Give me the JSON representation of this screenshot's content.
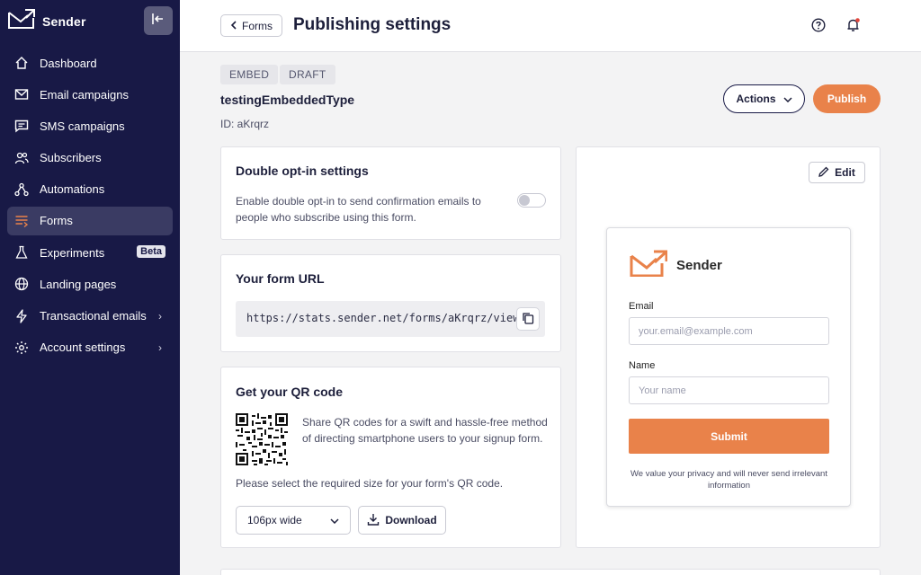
{
  "app": {
    "name": "Sender"
  },
  "sidebar": {
    "items": [
      {
        "label": "Dashboard",
        "icon": "home-icon"
      },
      {
        "label": "Email campaigns",
        "icon": "mail-icon"
      },
      {
        "label": "SMS campaigns",
        "icon": "message-icon"
      },
      {
        "label": "Subscribers",
        "icon": "users-icon"
      },
      {
        "label": "Automations",
        "icon": "automation-icon"
      },
      {
        "label": "Forms",
        "icon": "forms-icon",
        "active": true
      },
      {
        "label": "Experiments",
        "icon": "flask-icon",
        "badge": "Beta"
      },
      {
        "label": "Landing pages",
        "icon": "globe-icon"
      },
      {
        "label": "Transactional emails",
        "icon": "lightning-icon",
        "chevron": "›"
      },
      {
        "label": "Account settings",
        "icon": "gear-icon",
        "chevron": "›"
      }
    ]
  },
  "topbar": {
    "back_label": "Forms",
    "title": "Publishing settings"
  },
  "header": {
    "tags": [
      "EMBED",
      "DRAFT"
    ],
    "form_name": "testingEmbeddedType",
    "form_id": "ID: aKrqrz",
    "actions_label": "Actions",
    "publish_label": "Publish"
  },
  "double_optin": {
    "title": "Double opt-in settings",
    "description": "Enable double opt-in to send confirmation emails to people who subscribe using this form.",
    "enabled": false
  },
  "form_url": {
    "title": "Your form URL",
    "url": "https://stats.sender.net/forms/aKrqrz/view"
  },
  "qr": {
    "title": "Get your QR code",
    "description": "Share QR codes for a swift and hassle-free method of directing smartphone users to your signup form.",
    "size_prompt": "Please select the required size for your form's QR code.",
    "size_value": "106px wide",
    "download_label": "Download"
  },
  "preview": {
    "edit_label": "Edit",
    "logo_text": "Sender",
    "email_label": "Email",
    "email_placeholder": "your.email@example.com",
    "name_label": "Name",
    "name_placeholder": "Your name",
    "submit_label": "Submit",
    "privacy": "We value your privacy and will never send irrelevant information"
  },
  "colors": {
    "sidebar_bg": "#181946",
    "accent": "#e9824a",
    "active_item_bg": "#3a3b63"
  }
}
